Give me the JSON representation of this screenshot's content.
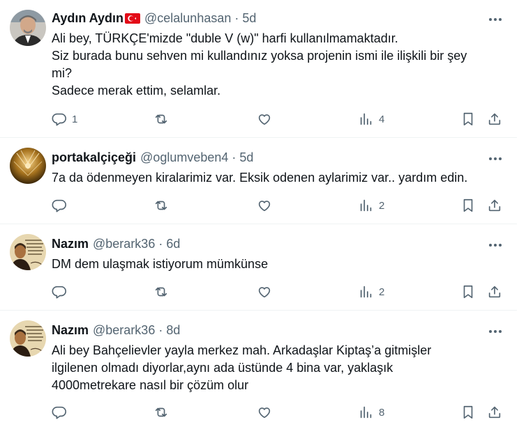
{
  "tweets": [
    {
      "name": "Aydın Aydın",
      "handle": "@celalunhasan",
      "dot": "·",
      "time": "5d",
      "lines": [
        "Ali bey, TÜRKÇE'mizde \"duble V (w)\" harfi kullanılmamaktadır.",
        "Siz burada bunu sehven mi kullandınız yoksa projenin ismi ile ilişkili bir şey",
        "mi?",
        "Sadece merak ettim, selamlar."
      ],
      "replies": "1",
      "views": "4"
    },
    {
      "name": "portakalçiçeği",
      "handle": "@oglumveben4",
      "dot": "·",
      "time": "5d",
      "lines": [
        "7a da ödenmeyen kiralarimiz var. Eksik odenen aylarimiz var.. yardım edin."
      ],
      "replies": "",
      "views": "2"
    },
    {
      "name": "Nazım",
      "handle": "@berark36",
      "dot": "·",
      "time": "6d",
      "lines": [
        "DM dem ulaşmak istiyorum mümkünse"
      ],
      "replies": "",
      "views": "2"
    },
    {
      "name": "Nazım",
      "handle": "@berark36",
      "dot": "·",
      "time": "8d",
      "lines": [
        "Ali bey Bahçelievler yayla merkez mah. Arkadaşlar Kiptaş’a gitmişler",
        "ilgilenen olmadı diyorlar,aynı ada üstünde 4 bina var, yaklaşık",
        "4000metrekare nasıl bir çözüm olur"
      ],
      "replies": "",
      "views": "8"
    }
  ],
  "icons": {
    "reply": "reply-icon",
    "repost": "repost-icon",
    "like": "like-icon",
    "views": "views-icon",
    "bookmark": "bookmark-icon",
    "share": "share-icon",
    "more": "more-icon",
    "flag": "turkish-flag-icon"
  },
  "colors": {
    "text": "#0f1419",
    "secondary": "#536471",
    "divider": "#eff3f4",
    "flag_red": "#e30a17"
  }
}
